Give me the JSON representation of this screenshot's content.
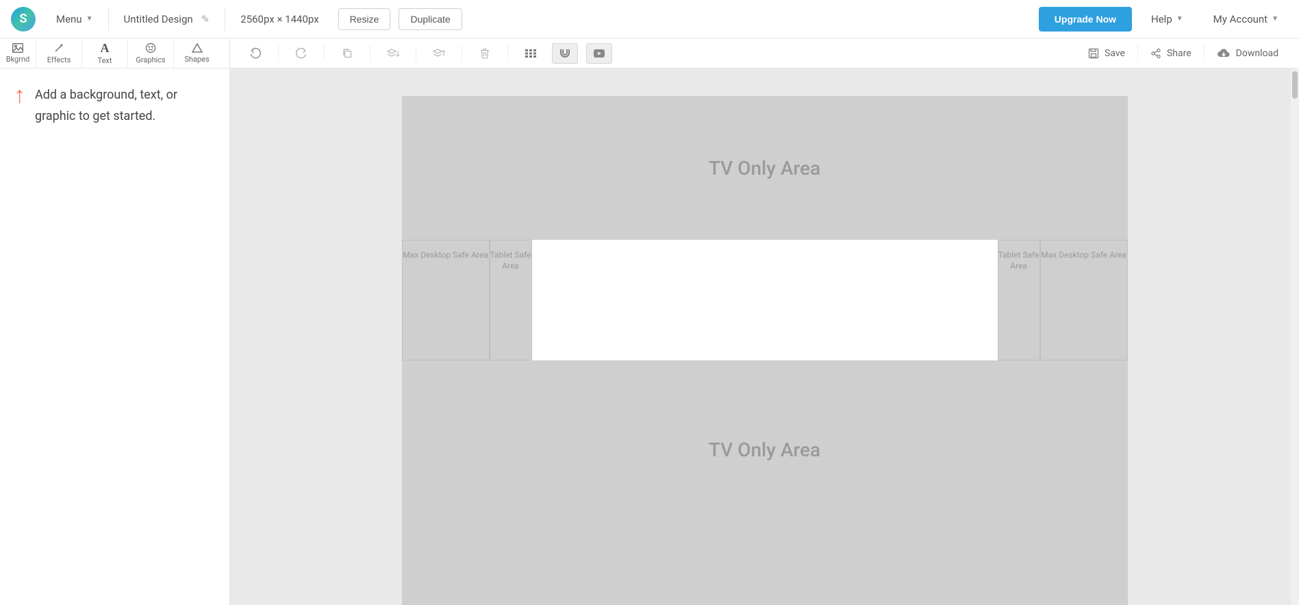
{
  "logo_letter": "S",
  "topbar": {
    "menu": "Menu",
    "title": "Untitled Design",
    "dimensions": "2560px × 1440px",
    "resize": "Resize",
    "duplicate": "Duplicate",
    "upgrade": "Upgrade Now",
    "help": "Help",
    "account": "My Account"
  },
  "tabs": {
    "bkgrnd": "Bkgrnd",
    "effects": "Effects",
    "text": "Text",
    "graphics": "Graphics",
    "shapes": "Shapes"
  },
  "actionbar": {
    "save": "Save",
    "share": "Share",
    "download": "Download"
  },
  "side": {
    "hint": "Add a background, text, or graphic to get started."
  },
  "canvas": {
    "tv_only": "TV Only Area",
    "max_desktop": "Max Desktop Safe Area",
    "tablet": "Tablet Safe Area"
  }
}
